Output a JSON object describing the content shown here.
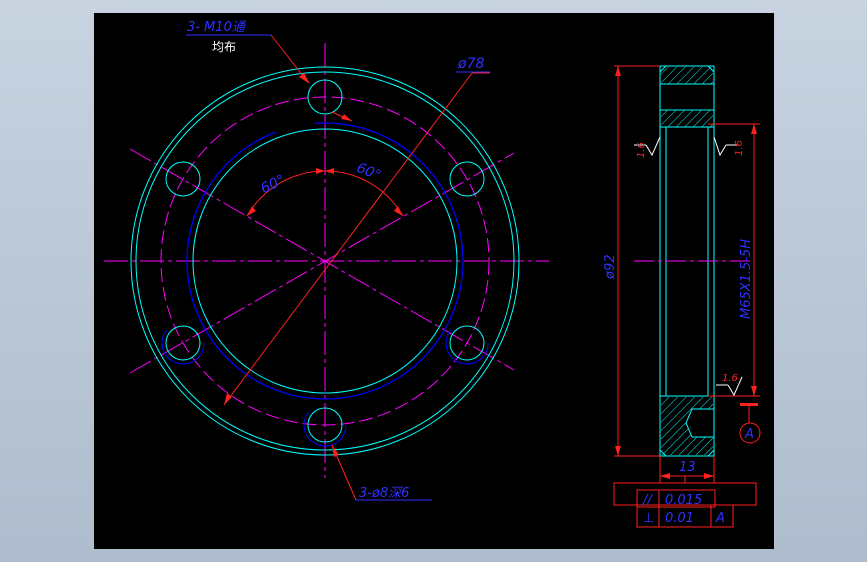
{
  "drawing": {
    "colors": {
      "background": "#000000",
      "outline": "#00ffff",
      "center_lines": "#ff00ff",
      "dimension": "#ff2020",
      "text": "#3030ff",
      "thread": "#0000ff",
      "frame": "#c8d3e0"
    },
    "front_view": {
      "callout_tapped_holes": {
        "line1": "3- M10通",
        "line2": "均布"
      },
      "outer_diameter_label": "ø78",
      "angle_left": "60°",
      "angle_right": "60°",
      "callout_counterbore": "3-ø8深6"
    },
    "side_view": {
      "diameter_label": "ø92",
      "thread_label": "M65X1.5-5H",
      "roughness_top_left": "1.6",
      "roughness_top_right": "1.6",
      "roughness_bottom_right": "1.6",
      "width_label": "13",
      "datum_label": "A"
    },
    "tolerance_frame": {
      "row1": {
        "symbol": "//",
        "value": "0.015"
      },
      "row2": {
        "symbol": "⊥",
        "value": "0.01",
        "datum": "A"
      }
    }
  }
}
